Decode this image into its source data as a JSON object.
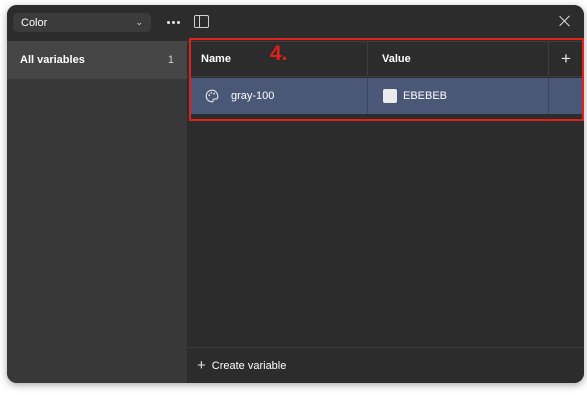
{
  "sidebar": {
    "collection_select": {
      "label": "Color"
    },
    "items": [
      {
        "label": "All variables",
        "count": "1"
      }
    ]
  },
  "table": {
    "columns": [
      "Name",
      "Value"
    ],
    "rows": [
      {
        "name": "gray-100",
        "value": "EBEBEB",
        "swatch_color": "#ebebeb"
      }
    ]
  },
  "footer": {
    "create_label": "Create variable"
  },
  "annotation": {
    "label": "4.",
    "color": "#e0201a"
  },
  "icons": {
    "collection_dropdown": "chevron-down-icon",
    "more": "more-horizontal-icon",
    "sidebar_toggle": "sidebar-toggle-icon",
    "close": "close-icon",
    "add_column": "plus-icon",
    "variable_type": "palette-icon",
    "create": "plus-icon"
  },
  "colors": {
    "selected_row": "#4a5777",
    "window_bg": "#2c2c2c",
    "sidebar_bg": "#383838"
  }
}
